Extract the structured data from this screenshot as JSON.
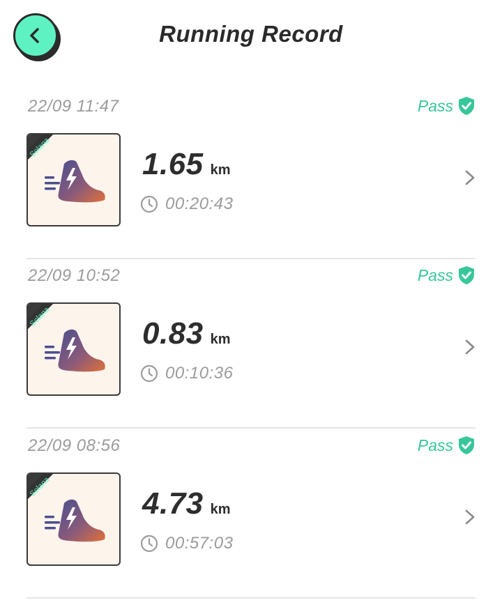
{
  "header": {
    "title": "Running Record",
    "back_icon": "chevron-left-icon"
  },
  "colors": {
    "accent": "#5ef2c2",
    "pass": "#37c79a",
    "text_dark": "#2d2d2d",
    "text_muted": "#9b9b9b"
  },
  "records": [
    {
      "datetime": "22/09 11:47",
      "status": "Pass",
      "distance": "1.65",
      "unit": "km",
      "duration": "00:20:43",
      "badge": "Solana"
    },
    {
      "datetime": "22/09 10:52",
      "status": "Pass",
      "distance": "0.83",
      "unit": "km",
      "duration": "00:10:36",
      "badge": "Solana"
    },
    {
      "datetime": "22/09 08:56",
      "status": "Pass",
      "distance": "4.73",
      "unit": "km",
      "duration": "00:57:03",
      "badge": "Solana"
    }
  ]
}
